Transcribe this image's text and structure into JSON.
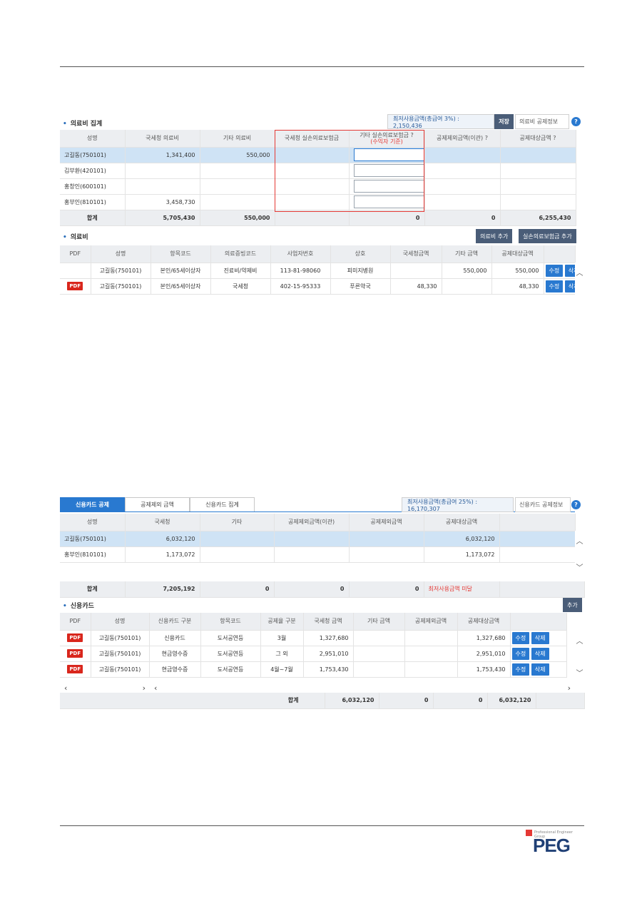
{
  "medical_summary": {
    "title": "의료비 집계",
    "info_text": "최저사용금액(총급여 3%) : 2,150,436",
    "save_label": "저장",
    "info_link": "의료비 공제정보",
    "help": "?",
    "headers": [
      "성명",
      "국세청 의료비",
      "기타 의료비",
      "국세청 실손의료보험금",
      "기타 실손의료보험금 ?",
      "공제제외금액(이관) ?",
      "공제대상금액 ?"
    ],
    "header_sub": "(수익자 기준)",
    "rows": [
      {
        "name": "고길동(750101)",
        "nts": "1,341,400",
        "other": "550,000"
      },
      {
        "name": "김부환(420101)",
        "nts": "",
        "other": ""
      },
      {
        "name": "홍창인(600101)",
        "nts": "",
        "other": ""
      },
      {
        "name": "홍부인(810101)",
        "nts": "3,458,730",
        "other": ""
      }
    ],
    "total": {
      "label": "합계",
      "nts": "5,705,430",
      "other": "550,000",
      "ins": "",
      "other_ins": "0",
      "excl": "0",
      "target": "6,255,430"
    }
  },
  "medical": {
    "title": "의료비",
    "add_label": "의료비 추가",
    "add_ins_label": "실손의료보험금 추가",
    "headers": [
      "PDF",
      "성명",
      "항목코드",
      "의료증빙코드",
      "사업자번호",
      "상호",
      "국세청금액",
      "기타 금액",
      "공제대상금액"
    ],
    "rows": [
      {
        "pdf": "",
        "name": "고길동(750101)",
        "code": "본인/65세이상자",
        "proof": "진료비/약제비",
        "biz": "113-81-98060",
        "shop": "피미지병원",
        "nts": "",
        "other": "550,000",
        "target": "550,000"
      },
      {
        "pdf": "PDF",
        "name": "고길동(750101)",
        "code": "본인/65세이상자",
        "proof": "국세청",
        "biz": "402-15-95333",
        "shop": "푸른약국",
        "nts": "48,330",
        "other": "",
        "target": "48,330"
      }
    ],
    "edit_label": "수정",
    "delete_label": "삭제"
  },
  "card_summary": {
    "tabs": [
      "신용카드 공제",
      "공제제외 금액",
      "신용카드 집계"
    ],
    "info_text": "최저사용금액(총급여 25%) : 16,170,307",
    "info_link": "신용카드 공제정보",
    "help": "?",
    "headers": [
      "성명",
      "국세청",
      "기타",
      "공제제외금액(이관)",
      "공제제외금액",
      "공제대상금액"
    ],
    "rows": [
      {
        "name": "고길동(750101)",
        "nts": "6,032,120",
        "target": "6,032,120"
      },
      {
        "name": "홍부인(810101)",
        "nts": "1,173,072",
        "target": "1,173,072"
      }
    ],
    "total": {
      "label": "합계",
      "nts": "7,205,192",
      "other": "0",
      "excl_t": "0",
      "excl": "0",
      "target": "최저사용금액 미달"
    }
  },
  "card": {
    "title": "신용카드",
    "add_label": "추가",
    "headers": [
      "PDF",
      "성명",
      "신용카드 구분",
      "항목코드",
      "공제율 구분",
      "국세청 금액",
      "기타 금액",
      "공제제외금액",
      "공제대상금액"
    ],
    "rows": [
      {
        "pdf": "PDF",
        "name": "고길동(750101)",
        "type": "신용카드",
        "code": "도서공연등",
        "rate": "3월",
        "nts": "1,327,680",
        "other": "",
        "excl": "",
        "target": "1,327,680"
      },
      {
        "pdf": "PDF",
        "name": "고길동(750101)",
        "type": "현금영수증",
        "code": "도서공연등",
        "rate": "그 외",
        "nts": "2,951,010",
        "other": "",
        "excl": "",
        "target": "2,951,010"
      },
      {
        "pdf": "PDF",
        "name": "고길동(750101)",
        "type": "현금영수증",
        "code": "도서공연등",
        "rate": "4월~7월",
        "nts": "1,753,430",
        "other": "",
        "excl": "",
        "target": "1,753,430"
      }
    ],
    "edit_label": "수정",
    "delete_label": "삭제",
    "total": {
      "label": "합계",
      "nts": "6,032,120",
      "other": "0",
      "excl": "0",
      "target": "6,032,120"
    }
  },
  "logo": {
    "tagline": "Professional Engineer Group",
    "text": "PEG"
  },
  "colors": {
    "accent": "#2979d0",
    "dark_button": "#4a5d78",
    "highlight": "#e53935",
    "selected_row": "#cfe3f5"
  }
}
